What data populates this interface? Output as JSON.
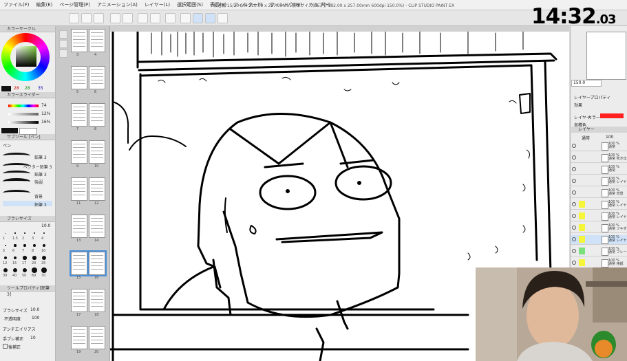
{
  "menubar": {
    "title": "横連載 15/20 (A4 210.00 x 297.00mm 製本サイズ(B5 判) 182.00 x 257.00mm 600dpi 150.0%) - CLIP STUDIO PAINT EX",
    "items": [
      "ファイル(F)",
      "編集(E)",
      "ページ管理(P)",
      "アニメーション(A)",
      "レイヤー(L)",
      "選択範囲(S)",
      "表示(V)",
      "フィルター(I)",
      "ウィンドウ(W)",
      "ヘルプ(H)"
    ]
  },
  "clock": {
    "main": "14:32",
    "seconds": ".03"
  },
  "left_panel": {
    "color_circle_title": "カラーサークル",
    "color_slider_title": "カラースライダー",
    "color_values": {
      "a": "28",
      "b": "28",
      "c": "35"
    },
    "slider_values": [
      "74",
      "12%",
      "16%"
    ],
    "subtool_title": "サブツール [ペン]",
    "pen_label": "ペン",
    "brushes": [
      "鉛筆 3",
      "ベクター鉛筆 3",
      "鉛筆 3",
      "強弱",
      "背景",
      "鉛筆 3"
    ],
    "brushsize_title": "ブラシサイズ",
    "size_value": "10.0",
    "size_labels": [
      "1",
      "1.5",
      "2",
      "3",
      "4",
      "5",
      "6",
      "7",
      "8",
      "10",
      "12",
      "15",
      "17",
      "20",
      "25",
      "30",
      "40",
      "50",
      "60",
      "70"
    ],
    "tool_prop_title": "ツールプロパティ[鉛筆 3]",
    "prop_rows": [
      {
        "label": "ブラシサイズ",
        "value": "10.0"
      },
      {
        "label": "不透明度",
        "value": "100"
      },
      {
        "label": "アンチエイリアス",
        "value": ""
      },
      {
        "label": "手ブレ補正",
        "value": "10"
      },
      {
        "label": "後補正",
        "value": ""
      }
    ]
  },
  "page_panel": {
    "page_numbers": [
      "3",
      "4",
      "5",
      "6",
      "7",
      "8",
      "9",
      "10",
      "11",
      "12",
      "13",
      "14",
      "15",
      "16",
      "17",
      "18",
      "19",
      "20"
    ]
  },
  "right_panel": {
    "zoom_value": "150.0",
    "layer_prop_title": "レイヤープロパティ",
    "effect_label": "効果",
    "layer_color_labels": [
      "レイヤー",
      "カラー"
    ],
    "layer_color_hex": "#ff2020",
    "subcolor_label": "各種色",
    "layers_title": "レイヤー",
    "blend_mode": "通常",
    "opacity": "100",
    "layers": [
      {
        "pct": "100 %",
        "name": "通常"
      },
      {
        "pct": "100 %",
        "name": "通常 吹き出し"
      },
      {
        "pct": "100 %",
        "name": "通常"
      },
      {
        "pct": "100 %",
        "name": "通常 レイヤー 1"
      },
      {
        "pct": "100 %",
        "name": "通常 背景"
      },
      {
        "pct": "100 %",
        "name": "通常 レイヤー"
      },
      {
        "pct": "100 %",
        "name": "通常 レイヤー"
      },
      {
        "pct": "100 %",
        "name": "通常 フキダシ"
      },
      {
        "pct": "100 %",
        "name": "通常 レイヤー 2"
      },
      {
        "pct": "100 %",
        "name": "通常 フレーム"
      },
      {
        "pct": "100 %",
        "name": "通常 用紙"
      },
      {
        "pct": "100 %",
        "name": "通常 主線"
      },
      {
        "pct": "100 %",
        "name": "通常 ペン"
      }
    ]
  },
  "colors": {
    "accent": "#4a90d9",
    "selected_layer": "#cfe2f7",
    "highlight": "#f5f53a",
    "green": "#7be07b"
  }
}
